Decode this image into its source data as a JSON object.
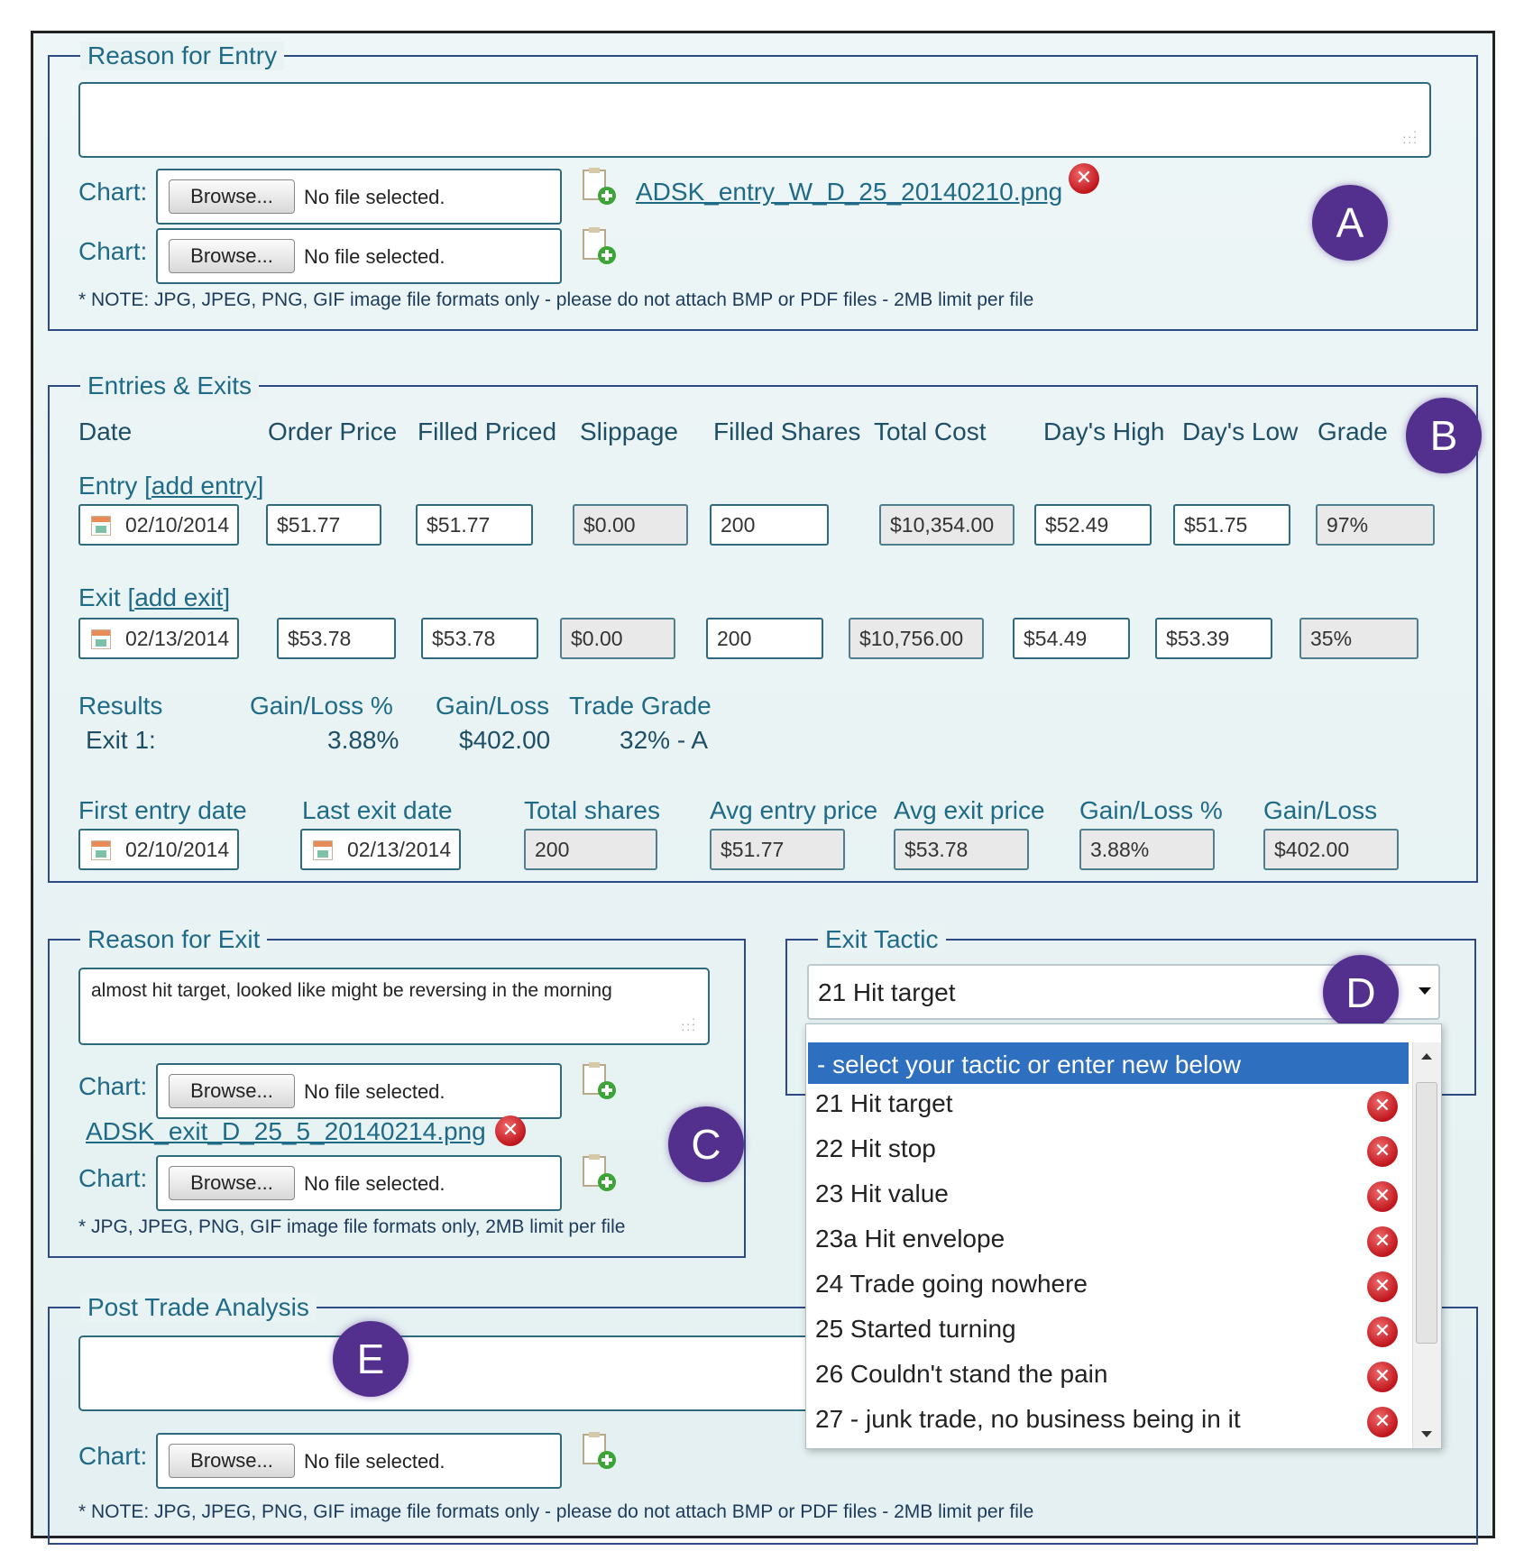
{
  "reason_for_entry": {
    "legend": "Reason for Entry",
    "chart_label": "Chart:",
    "browse_label": "Browse...",
    "no_file": "No file selected.",
    "attached_file": "ADSK_entry_W_D_25_20140210.png",
    "note": "* NOTE: JPG, JPEG, PNG, GIF image file formats only - please do not attach BMP or PDF files - 2MB limit per file",
    "badge": "A"
  },
  "entries_exits": {
    "legend": "Entries & Exits",
    "badge": "B",
    "headers": [
      "Date",
      "Order Price",
      "Filled Priced",
      "Slippage",
      "Filled Shares",
      "Total Cost",
      "Day's High",
      "Day's Low",
      "Grade"
    ],
    "entry_label": "Entry [",
    "entry_link": "add entry",
    "entry_close": "]",
    "entry": [
      "02/10/2014",
      "$51.77",
      "$51.77",
      "$0.00",
      "200",
      "$10,354.00",
      "$52.49",
      "$51.75",
      "97%"
    ],
    "exit_label": "Exit [",
    "exit_link": "add exit",
    "exit_close": "]",
    "exit": [
      "02/13/2014",
      "$53.78",
      "$53.78",
      "$0.00",
      "200",
      "$10,756.00",
      "$54.49",
      "$53.39",
      "35%"
    ],
    "results_headers": [
      "Results",
      "Gain/Loss %",
      "Gain/Loss",
      "Trade Grade"
    ],
    "results_row": [
      "Exit 1:",
      "3.88%",
      "$402.00",
      "32% - A"
    ],
    "summary_headers": [
      "First entry date",
      "Last exit date",
      "Total shares",
      "Avg entry price",
      "Avg exit price",
      "Gain/Loss %",
      "Gain/Loss"
    ],
    "summary_values": [
      "02/10/2014",
      "02/13/2014",
      "200",
      "$51.77",
      "$53.78",
      "3.88%",
      "$402.00"
    ]
  },
  "reason_for_exit": {
    "legend": "Reason for Exit",
    "text": "almost hit target, looked like might be reversing in the morning",
    "chart_label": "Chart:",
    "browse_label": "Browse...",
    "no_file": "No file selected.",
    "attached_file": "ADSK_exit_D_25_5_20140214.png",
    "note": "* JPG, JPEG, PNG, GIF image file formats only, 2MB limit per file",
    "badge": "C"
  },
  "exit_tactic": {
    "legend": "Exit Tactic",
    "selected": "21 Hit target",
    "badge": "D",
    "placeholder_option": "- select your tactic or enter new below",
    "options": [
      "21 Hit target",
      "22 Hit stop",
      "23 Hit value",
      "23a Hit envelope",
      "24 Trade going nowhere",
      "25 Started turning",
      "26 Couldn't stand the pain",
      "27 - junk trade, no business being in it"
    ]
  },
  "post_trade": {
    "legend": "Post Trade Analysis",
    "chart_label": "Chart:",
    "browse_label": "Browse...",
    "no_file": "No file selected.",
    "note": "* NOTE: JPG, JPEG, PNG, GIF image file formats only - please do not attach BMP or PDF files - 2MB limit per file",
    "badge": "E"
  },
  "icons": {
    "add_file": "add-file-icon",
    "remove": "remove-icon",
    "calendar": "calendar-icon",
    "dropdown": "chevron-down-icon"
  },
  "colors": {
    "badge": "#53308d",
    "link": "#1f6a86",
    "remove": "#c0161e",
    "selected_option": "#2f6fc0"
  }
}
